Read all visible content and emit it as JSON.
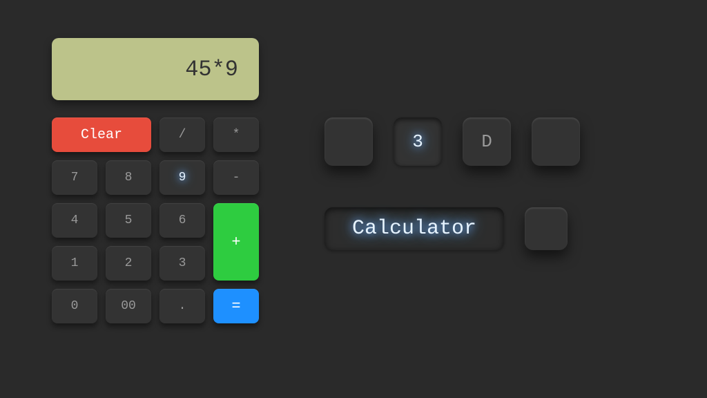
{
  "calculator": {
    "display": "45*9",
    "buttons": {
      "clear": "Clear",
      "divide": "/",
      "multiply": "*",
      "n7": "7",
      "n8": "8",
      "n9": "9",
      "minus": "-",
      "n4": "4",
      "n5": "5",
      "n6": "6",
      "plus": "+",
      "n1": "1",
      "n2": "2",
      "n3": "3",
      "n0": "0",
      "n00": "00",
      "dot": ".",
      "equals": "="
    }
  },
  "showcase": {
    "key1": "",
    "key2": "3",
    "key3": "D",
    "key4": "",
    "wide": "Calculator",
    "square": ""
  }
}
